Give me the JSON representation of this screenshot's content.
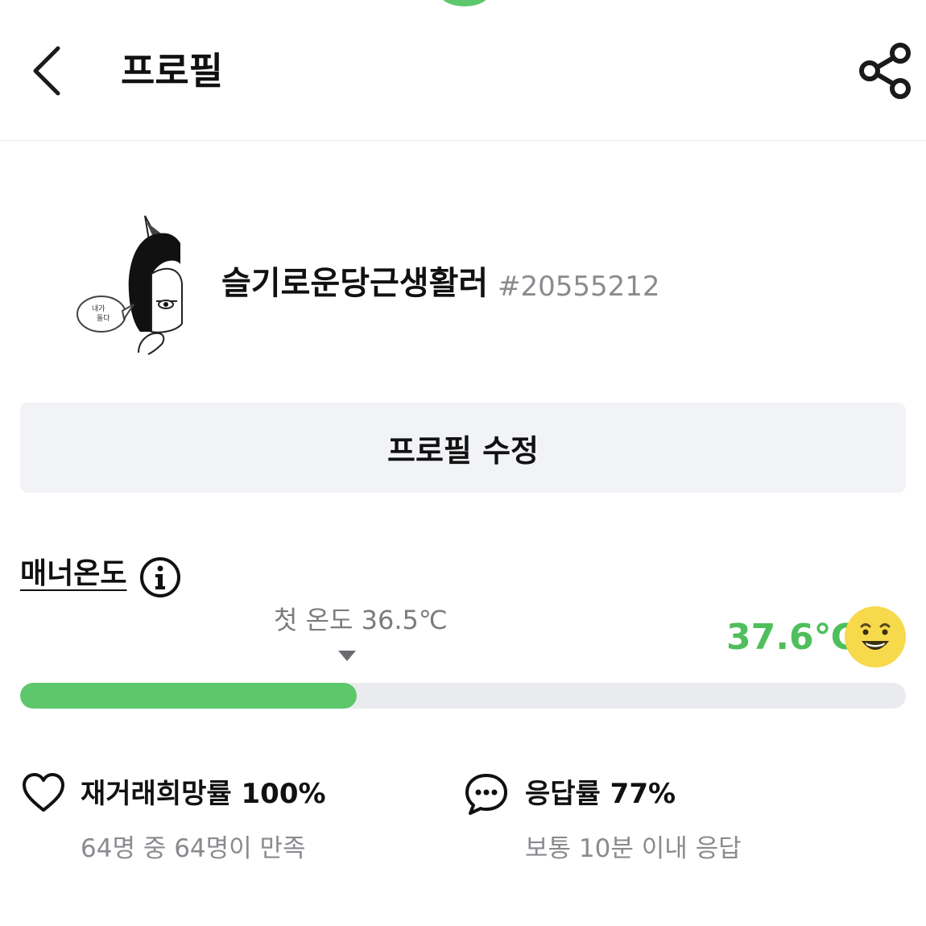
{
  "header": {
    "title": "프로필",
    "back_icon": "chevron-left-icon",
    "share_icon": "share-icon"
  },
  "profile": {
    "nickname": "슬기로운당근생활러",
    "user_id": "#20555212",
    "avatar_icon": "avatar-illustration",
    "avatar_bubble_text": "내가 \n 돌다"
  },
  "edit_button": {
    "label": "프로필 수정"
  },
  "manner": {
    "label": "매너온도",
    "info_icon": "info-icon",
    "first_temp_label": "첫 온도 36.5℃",
    "temperature": "37.6℃",
    "progress": 0.38,
    "accent_color": "#5cc86b",
    "emoji_icon": "smiley-face-icon"
  },
  "stats": {
    "rebuy": {
      "icon": "heart-icon",
      "label": "재거래희망률 100%",
      "sub": "64명 중 64명이 만족"
    },
    "response": {
      "icon": "chat-bubble-icon",
      "label": "응답률 77%",
      "sub": "보통 10분 이내 응답"
    }
  }
}
